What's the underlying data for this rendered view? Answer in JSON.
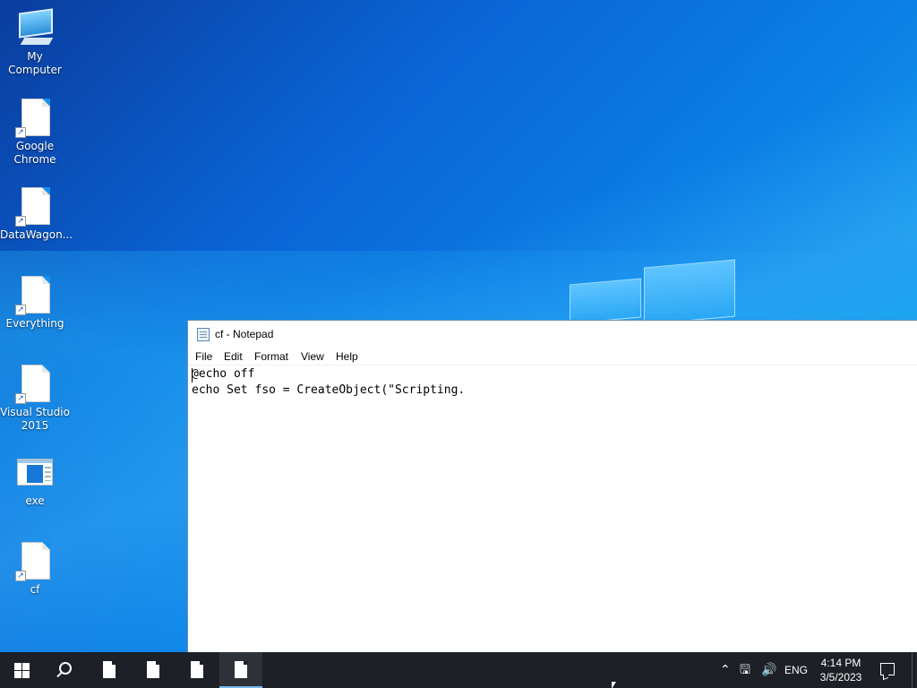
{
  "desktop": {
    "icons": [
      {
        "label": "My Computer",
        "icon": "computer-icon"
      },
      {
        "label": "Google Chrome",
        "icon": "document-shortcut-icon"
      },
      {
        "label": "DataWagon...",
        "icon": "document-shortcut-icon"
      },
      {
        "label": "Everything",
        "icon": "document-shortcut-icon"
      },
      {
        "label": "Visual Studio 2015",
        "icon": "document-shortcut-icon"
      },
      {
        "label": "exe",
        "icon": "exe-window-icon"
      },
      {
        "label": "cf",
        "icon": "document-shortcut-icon"
      }
    ]
  },
  "notepad": {
    "title": "cf - Notepad",
    "menu": [
      "File",
      "Edit",
      "Format",
      "View",
      "Help"
    ],
    "content": "@echo off\necho Set fso = CreateObject(\"Scripting."
  },
  "taskbar": {
    "language": "ENG",
    "time": "4:14 PM",
    "date": "3/5/2023",
    "accent": "#76b9ed"
  }
}
